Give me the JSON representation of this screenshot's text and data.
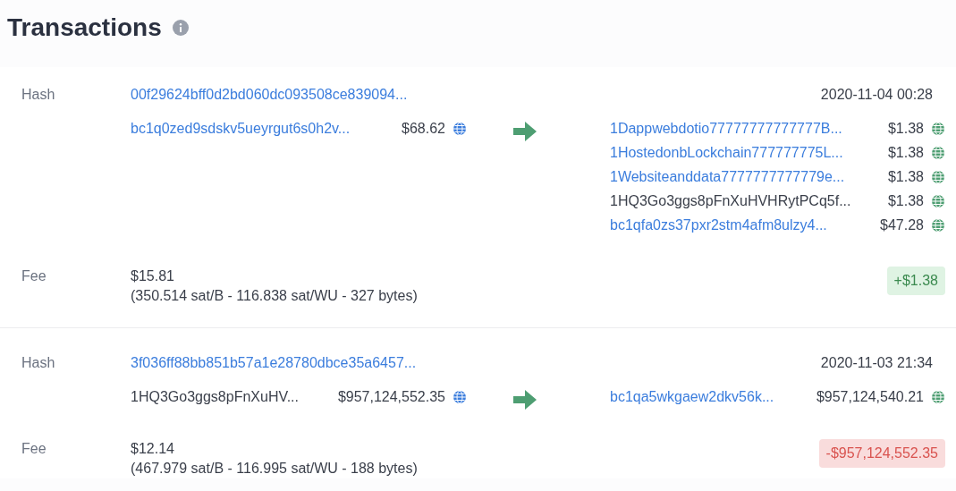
{
  "title": "Transactions",
  "transactions": [
    {
      "hash_label": "Hash",
      "hash": "00f29624bff0d2bd060dc093508ce839094...",
      "date": "2020-11-04 00:28",
      "inputs": [
        {
          "address": "bc1q0zed9sdskv5ueyrgut6s0h2v...",
          "link": true,
          "amount": "$68.62"
        }
      ],
      "outputs": [
        {
          "address": "1Dappwebdotio77777777777777B...",
          "link": true,
          "amount": "$1.38"
        },
        {
          "address": "1HostedonbLockchain777777775L...",
          "link": true,
          "amount": "$1.38"
        },
        {
          "address": "1Websiteanddata7777777777779e...",
          "link": true,
          "amount": "$1.38"
        },
        {
          "address": "1HQ3Go3ggs8pFnXuHVHRytPCq5f...",
          "link": false,
          "amount": "$1.38"
        },
        {
          "address": "bc1qfa0zs37pxr2stm4afm8ulzy4...",
          "link": true,
          "amount": "$47.28"
        }
      ],
      "fee_label": "Fee",
      "fee": "$15.81",
      "fee_detail": "(350.514 sat/B - 116.838 sat/WU - 327 bytes)",
      "balance": {
        "text": "+$1.38",
        "kind": "positive"
      }
    },
    {
      "hash_label": "Hash",
      "hash": "3f036ff88bb851b57a1e28780dbce35a6457...",
      "date": "2020-11-03 21:34",
      "inputs": [
        {
          "address": "1HQ3Go3ggs8pFnXuHV...",
          "link": false,
          "amount": "$957,124,552.35"
        }
      ],
      "outputs": [
        {
          "address": "bc1qa5wkgaew2dkv56k...",
          "link": true,
          "amount": "$957,124,540.21"
        }
      ],
      "fee_label": "Fee",
      "fee": "$12.14",
      "fee_detail": "(467.979 sat/B - 116.995 sat/WU - 188 bytes)",
      "balance": {
        "text": "-$957,124,552.35",
        "kind": "negative"
      }
    }
  ]
}
